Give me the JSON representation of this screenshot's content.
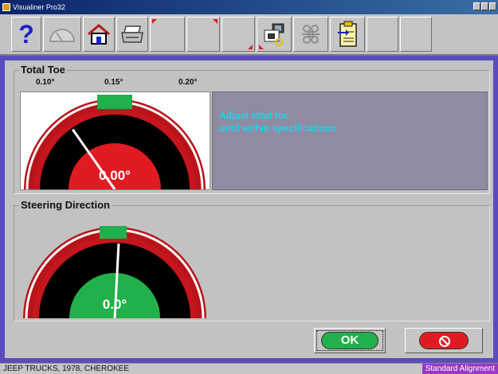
{
  "window": {
    "title": "Visualiner Pro32"
  },
  "toolbar": {
    "items": [
      {
        "icon": "help-icon"
      },
      {
        "icon": "gauge-icon"
      },
      {
        "icon": "home-icon"
      },
      {
        "icon": "printer-icon"
      },
      {
        "icon": "blank"
      },
      {
        "icon": "blank"
      },
      {
        "icon": "blank"
      },
      {
        "icon": "vehicle-camera-icon"
      },
      {
        "icon": "network-icon"
      },
      {
        "icon": "clipboard-arrow-icon"
      },
      {
        "icon": "blank"
      },
      {
        "icon": "blank"
      }
    ]
  },
  "total_toe": {
    "title": "Total Toe",
    "scale_labels": [
      "0.10°",
      "0.15°",
      "0.20°"
    ],
    "value": "0.00°",
    "message_line1": "Adjust total toe",
    "message_line2": "until within specifications",
    "gauge_color": "#e11b22",
    "needle_angle_deg": -35
  },
  "steering": {
    "title": "Steering Direction",
    "value": "0.0°",
    "gauge_color": "#21b04b",
    "needle_angle_deg": 3
  },
  "buttons": {
    "ok": "OK"
  },
  "status": {
    "vehicle": "JEEP TRUCKS, 1978, CHEROKEE",
    "mode": "Standard Alignment"
  },
  "colors": {
    "frame": "#5b4bc1",
    "message_text": "#23d2e8",
    "status_mode_bg": "#9a38c8"
  }
}
